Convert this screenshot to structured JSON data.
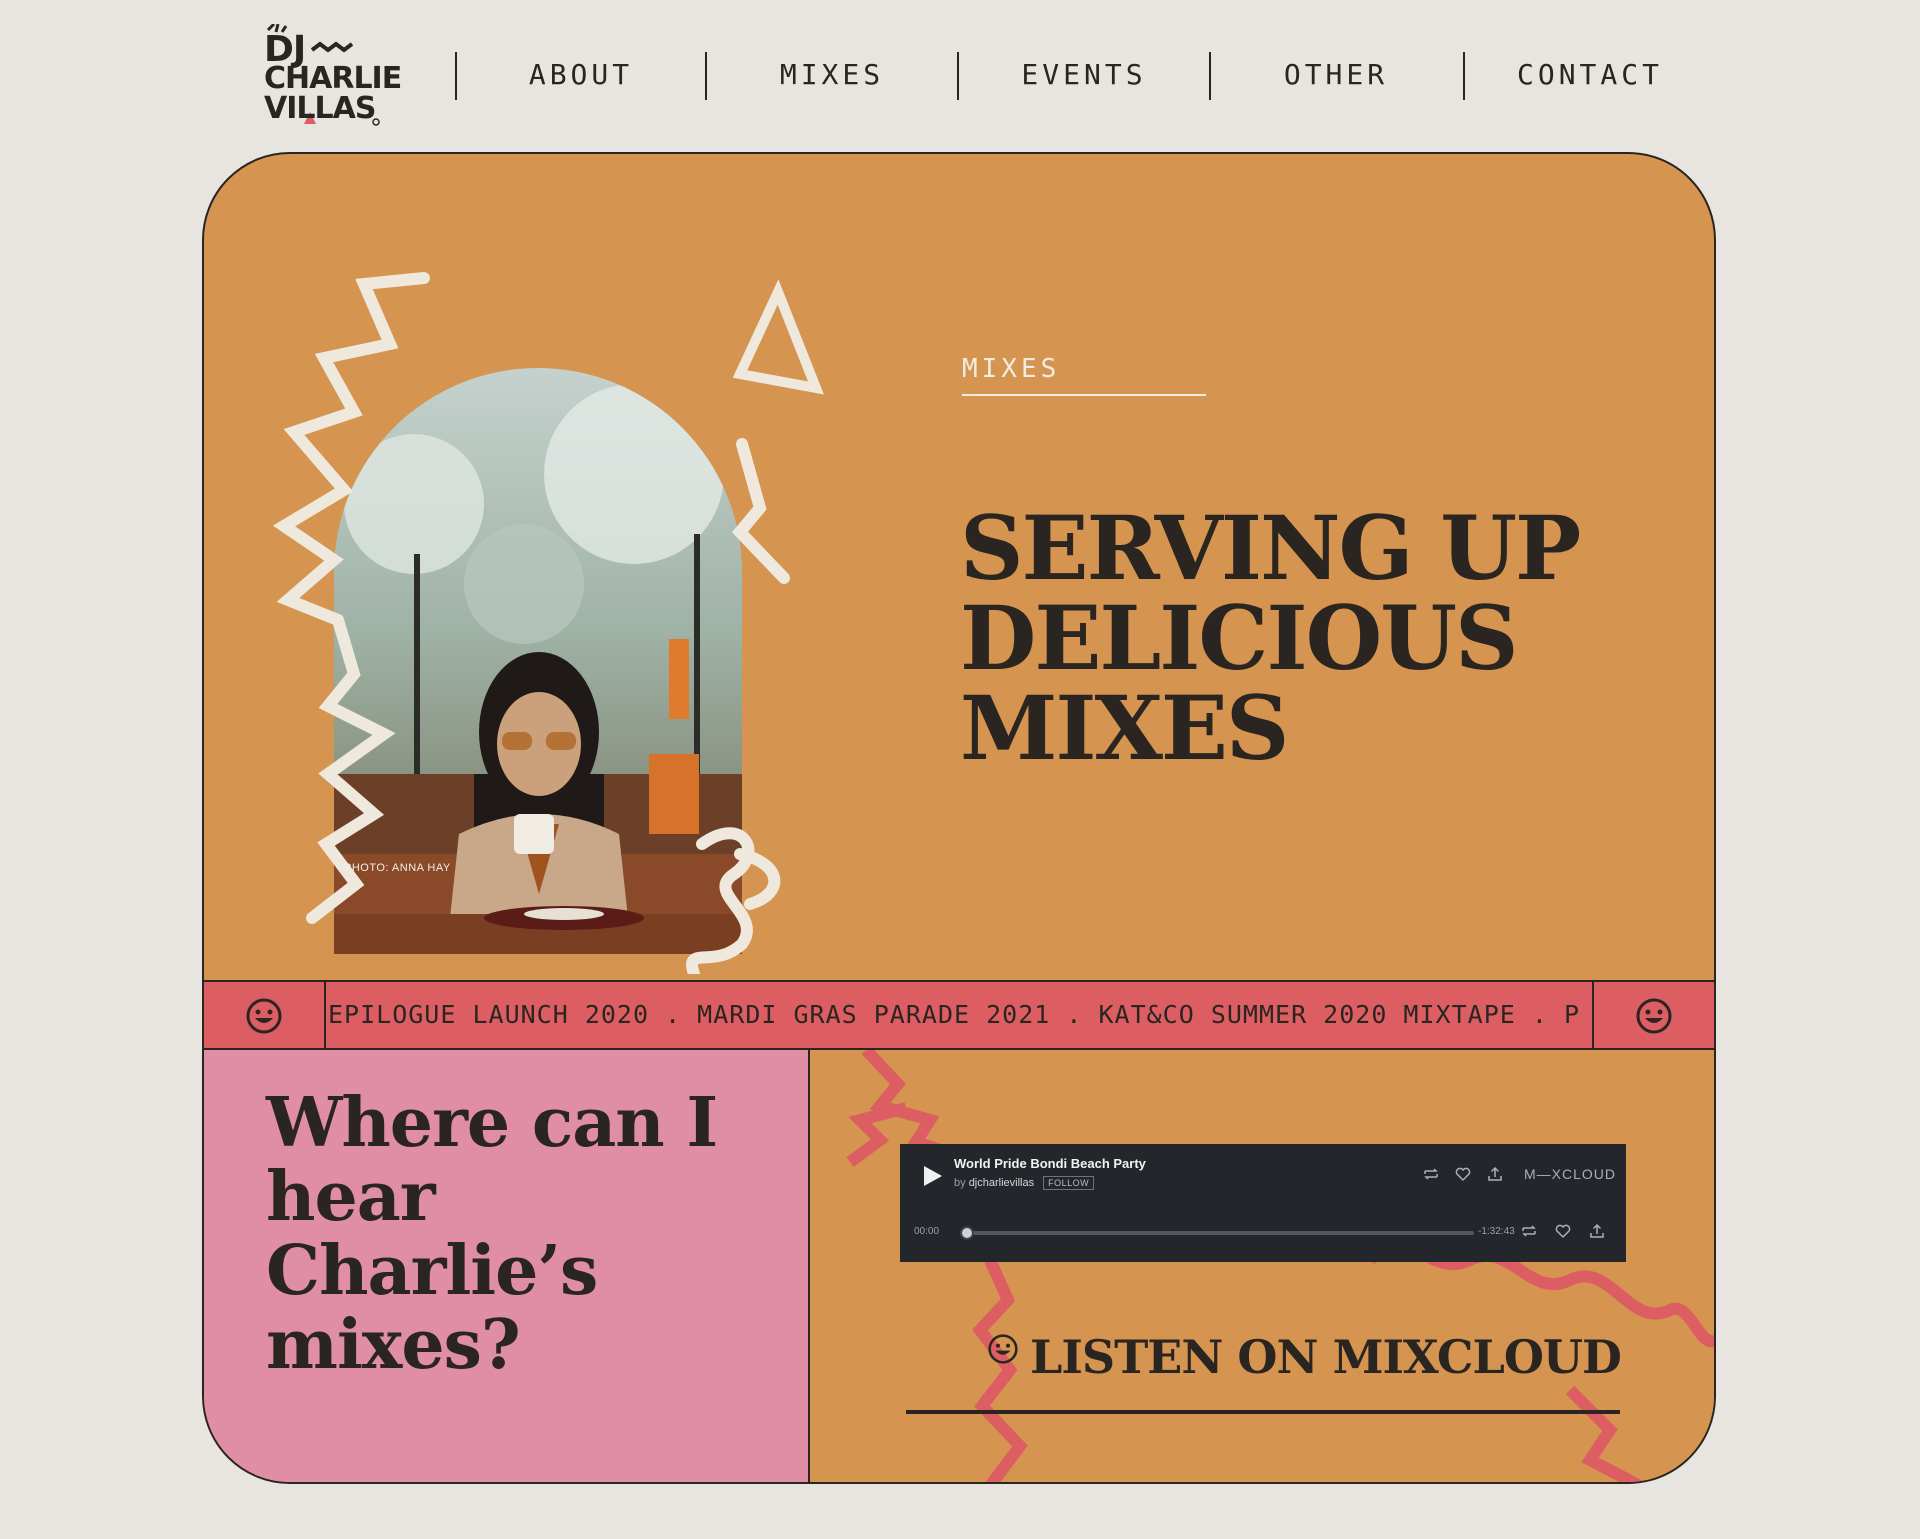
{
  "logo": {
    "line1": "DJ",
    "line2": "CHARLIE",
    "line3": "VILLAS"
  },
  "nav": {
    "items": [
      "ABOUT",
      "MIXES",
      "EVENTS",
      "OTHER",
      "CONTACT"
    ]
  },
  "hero": {
    "eyebrow": "MIXES",
    "title": "SERVING UP DELICIOUS MIXES",
    "photo_credit": "PHOTO: ANNA HAY"
  },
  "ticker": {
    "text": "EPILOGUE LAUNCH 2020 . MARDI GRAS PARADE 2021 . KAT&CO SUMMER 2020 MIXTAPE . P O O L S I D E . POOF"
  },
  "section": {
    "question": "Where can I hear Charlie’s mixes?"
  },
  "player": {
    "title": "World Pride Bondi Beach Party",
    "by_label": "by",
    "user": "djcharlievillas",
    "follow": "FOLLOW",
    "brand": "M—XCLOUD",
    "time_elapsed": "00:00",
    "time_remaining": "-1:32:43",
    "progress": 0
  },
  "cta": {
    "label": "LISTEN ON MIXCLOUD"
  },
  "colors": {
    "background": "#e8e5e0",
    "orange": "#d59450",
    "pink": "#e08ea6",
    "red": "#dd5e62",
    "ink": "#2a2521",
    "cream": "#f2ece2",
    "player_bg": "#23272b"
  }
}
